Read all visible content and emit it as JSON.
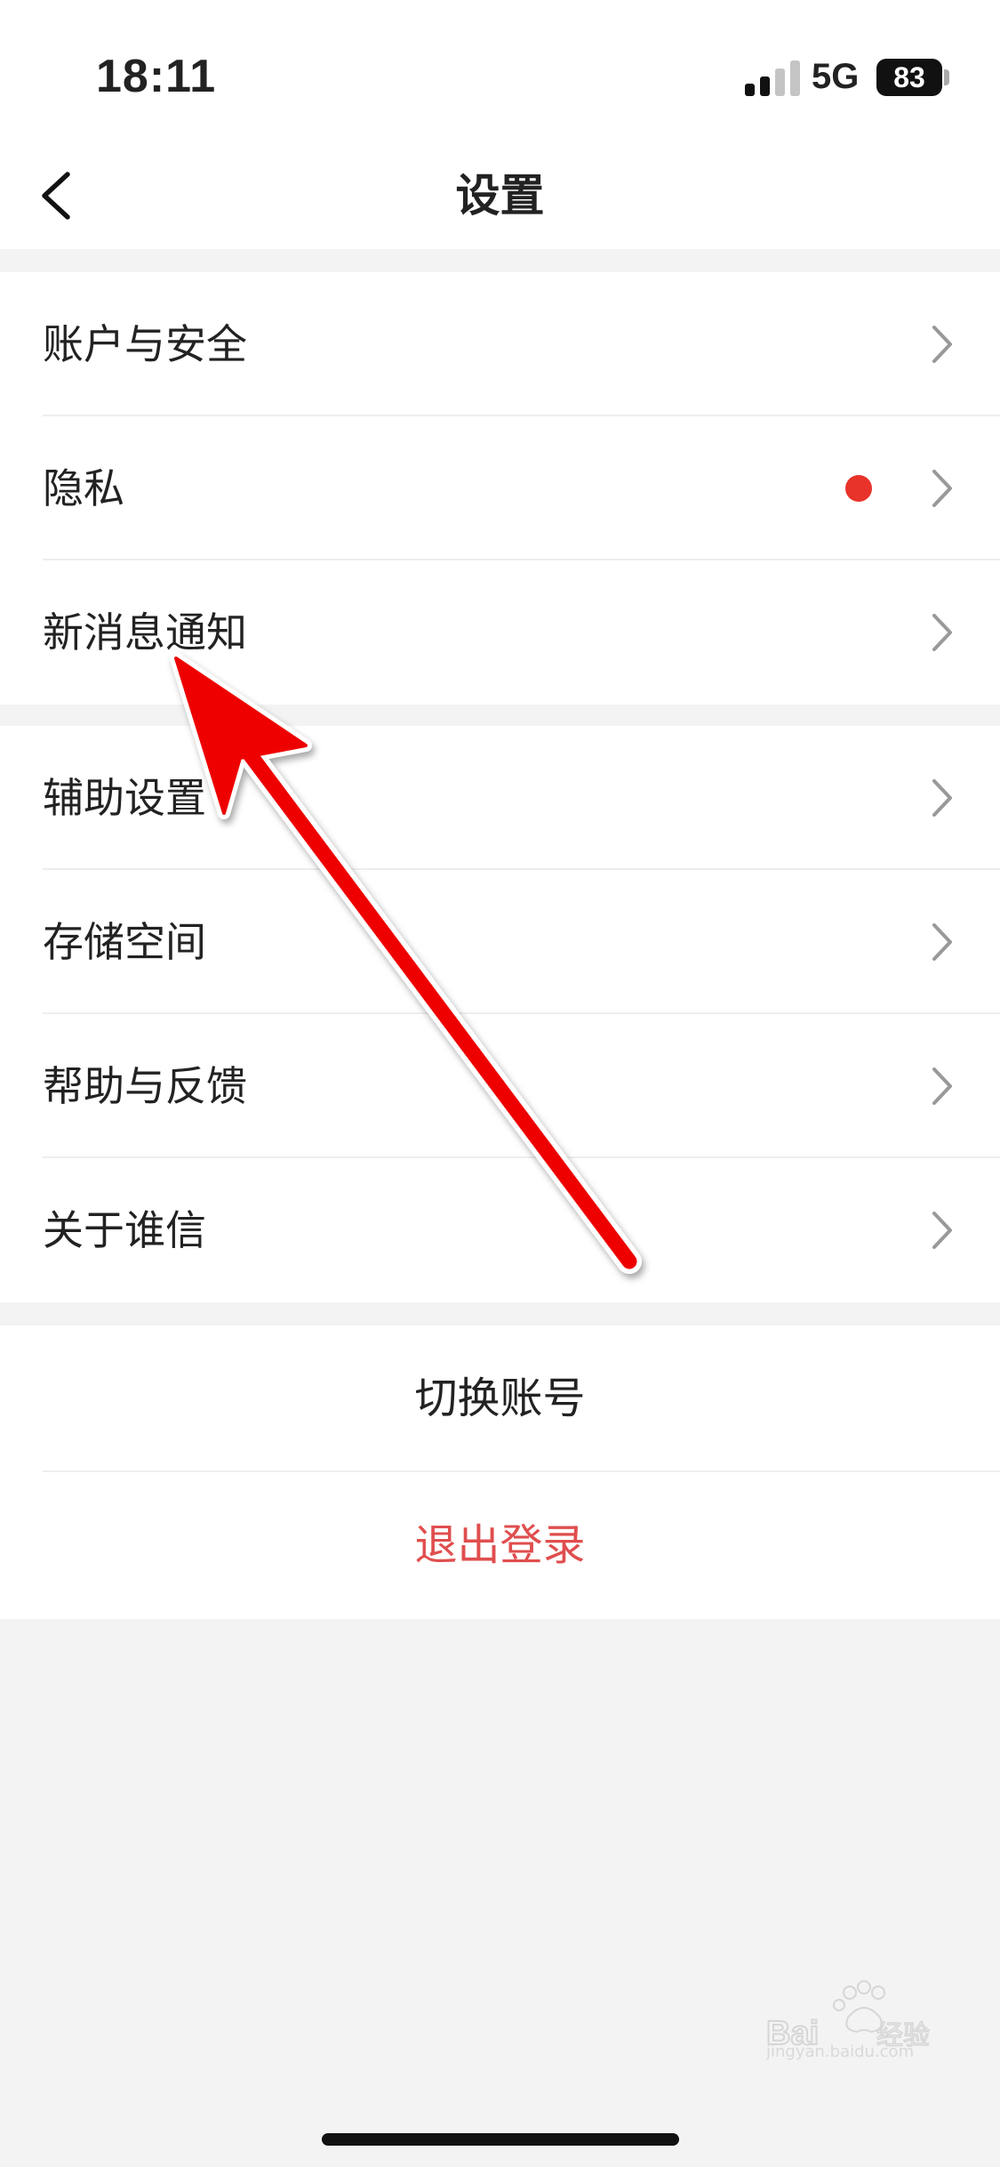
{
  "status_bar": {
    "time": "18:11",
    "network": "5G",
    "battery": "83"
  },
  "nav": {
    "title": "设置"
  },
  "groups": [
    {
      "items": [
        {
          "label": "账户与安全"
        },
        {
          "label": "隐私"
        },
        {
          "label": "新消息通知"
        }
      ]
    },
    {
      "items": [
        {
          "label": "辅助设置"
        },
        {
          "label": "存储空间"
        },
        {
          "label": "帮助与反馈"
        },
        {
          "label": "关于谁信"
        }
      ]
    }
  ],
  "actions": {
    "switch_account": "切换账号",
    "logout": "退出登录"
  },
  "colors": {
    "accent_red": "#e8332a",
    "logout_text": "#e04e4e",
    "annotation_arrow": "#ee0000"
  },
  "watermark": {
    "text": "jingyan.baidu.com"
  }
}
